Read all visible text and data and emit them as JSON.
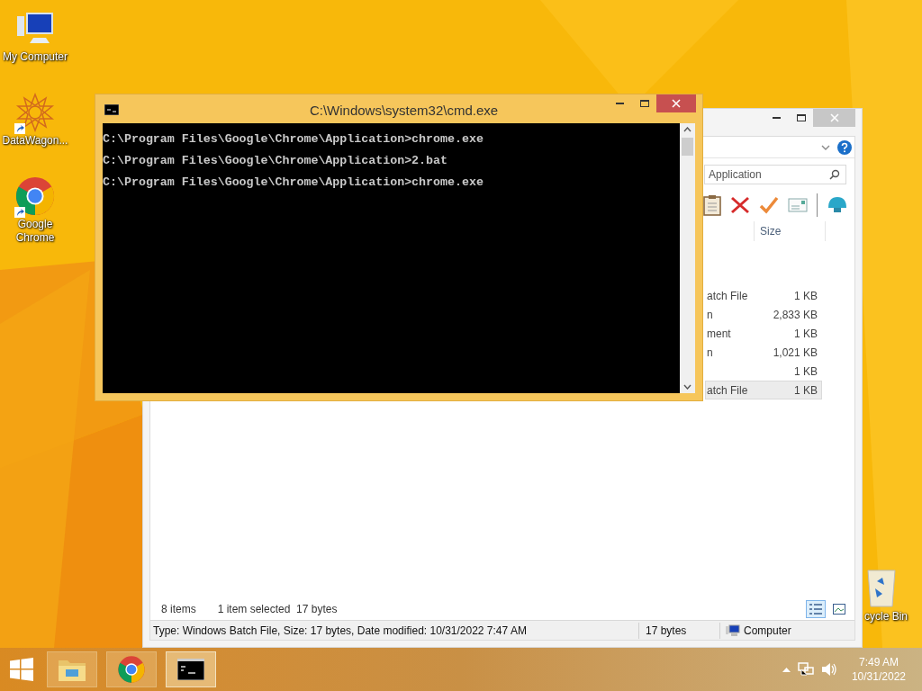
{
  "desktop_icons": [
    {
      "label": "My Computer",
      "kind": "computer",
      "shortcut": false
    },
    {
      "label": "DataWagon...",
      "kind": "star",
      "shortcut": true
    },
    {
      "label": "Google Chrome",
      "kind": "chrome",
      "shortcut": true
    }
  ],
  "recycle_bin": {
    "label": "cycle Bin"
  },
  "explorer": {
    "search_value": "Application",
    "column": "Size",
    "rows": [
      {
        "name": "atch File",
        "size": "1 KB",
        "selected": false
      },
      {
        "name": "n",
        "size": "2,833 KB",
        "selected": false
      },
      {
        "name": "ment",
        "size": "1 KB",
        "selected": false
      },
      {
        "name": "n",
        "size": "1,021 KB",
        "selected": false
      },
      {
        "size": "1 KB",
        "selected": false
      },
      {
        "name": "atch File",
        "size": "1 KB",
        "selected": true
      }
    ],
    "item_count": "8 items",
    "selection_info": "1 item selected  17 bytes",
    "views": [
      {
        "kind": "details",
        "selected": true
      },
      {
        "kind": "tiles",
        "selected": false
      }
    ],
    "details": "Type: Windows Batch File, Size: 17 bytes, Date modified: 10/31/2022 7:47 AM",
    "size": "17 bytes",
    "location": "Computer"
  },
  "cmd": {
    "title": "C:\\Windows\\system32\\cmd.exe",
    "lines": [
      "C:\\Program Files\\Google\\Chrome\\Application>chrome.exe",
      "C:\\Program Files\\Google\\Chrome\\Application>2.bat",
      "C:\\Program Files\\Google\\Chrome\\Application>chrome.exe"
    ]
  },
  "taskbar": {
    "apps": [
      {
        "kind": "explorer",
        "active": false
      },
      {
        "kind": "chrome",
        "active": false
      },
      {
        "kind": "cmd",
        "active": true
      }
    ],
    "time": "7:49 AM",
    "date": "10/31/2022"
  }
}
